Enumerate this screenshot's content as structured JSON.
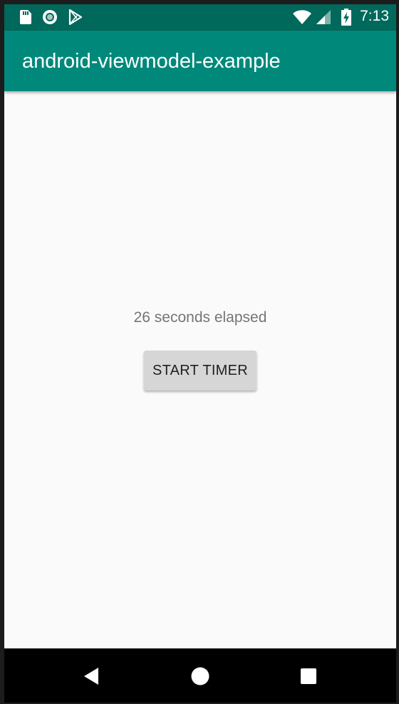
{
  "status_bar": {
    "time": "7:13",
    "icons": [
      "sd-card-icon",
      "sync-circle-icon",
      "play-store-icon",
      "wifi-icon",
      "cell-signal-icon",
      "battery-charging-icon"
    ]
  },
  "app_bar": {
    "title": "android-viewmodel-example"
  },
  "main": {
    "elapsed_text": "26 seconds elapsed",
    "start_button_label": "START TIMER"
  },
  "nav_bar": {
    "buttons": [
      "back-icon",
      "home-icon",
      "recents-icon"
    ]
  },
  "colors": {
    "status_bar": "#00695c",
    "app_bar": "#00897b",
    "background": "#fafafa",
    "button": "#d6d6d6"
  }
}
